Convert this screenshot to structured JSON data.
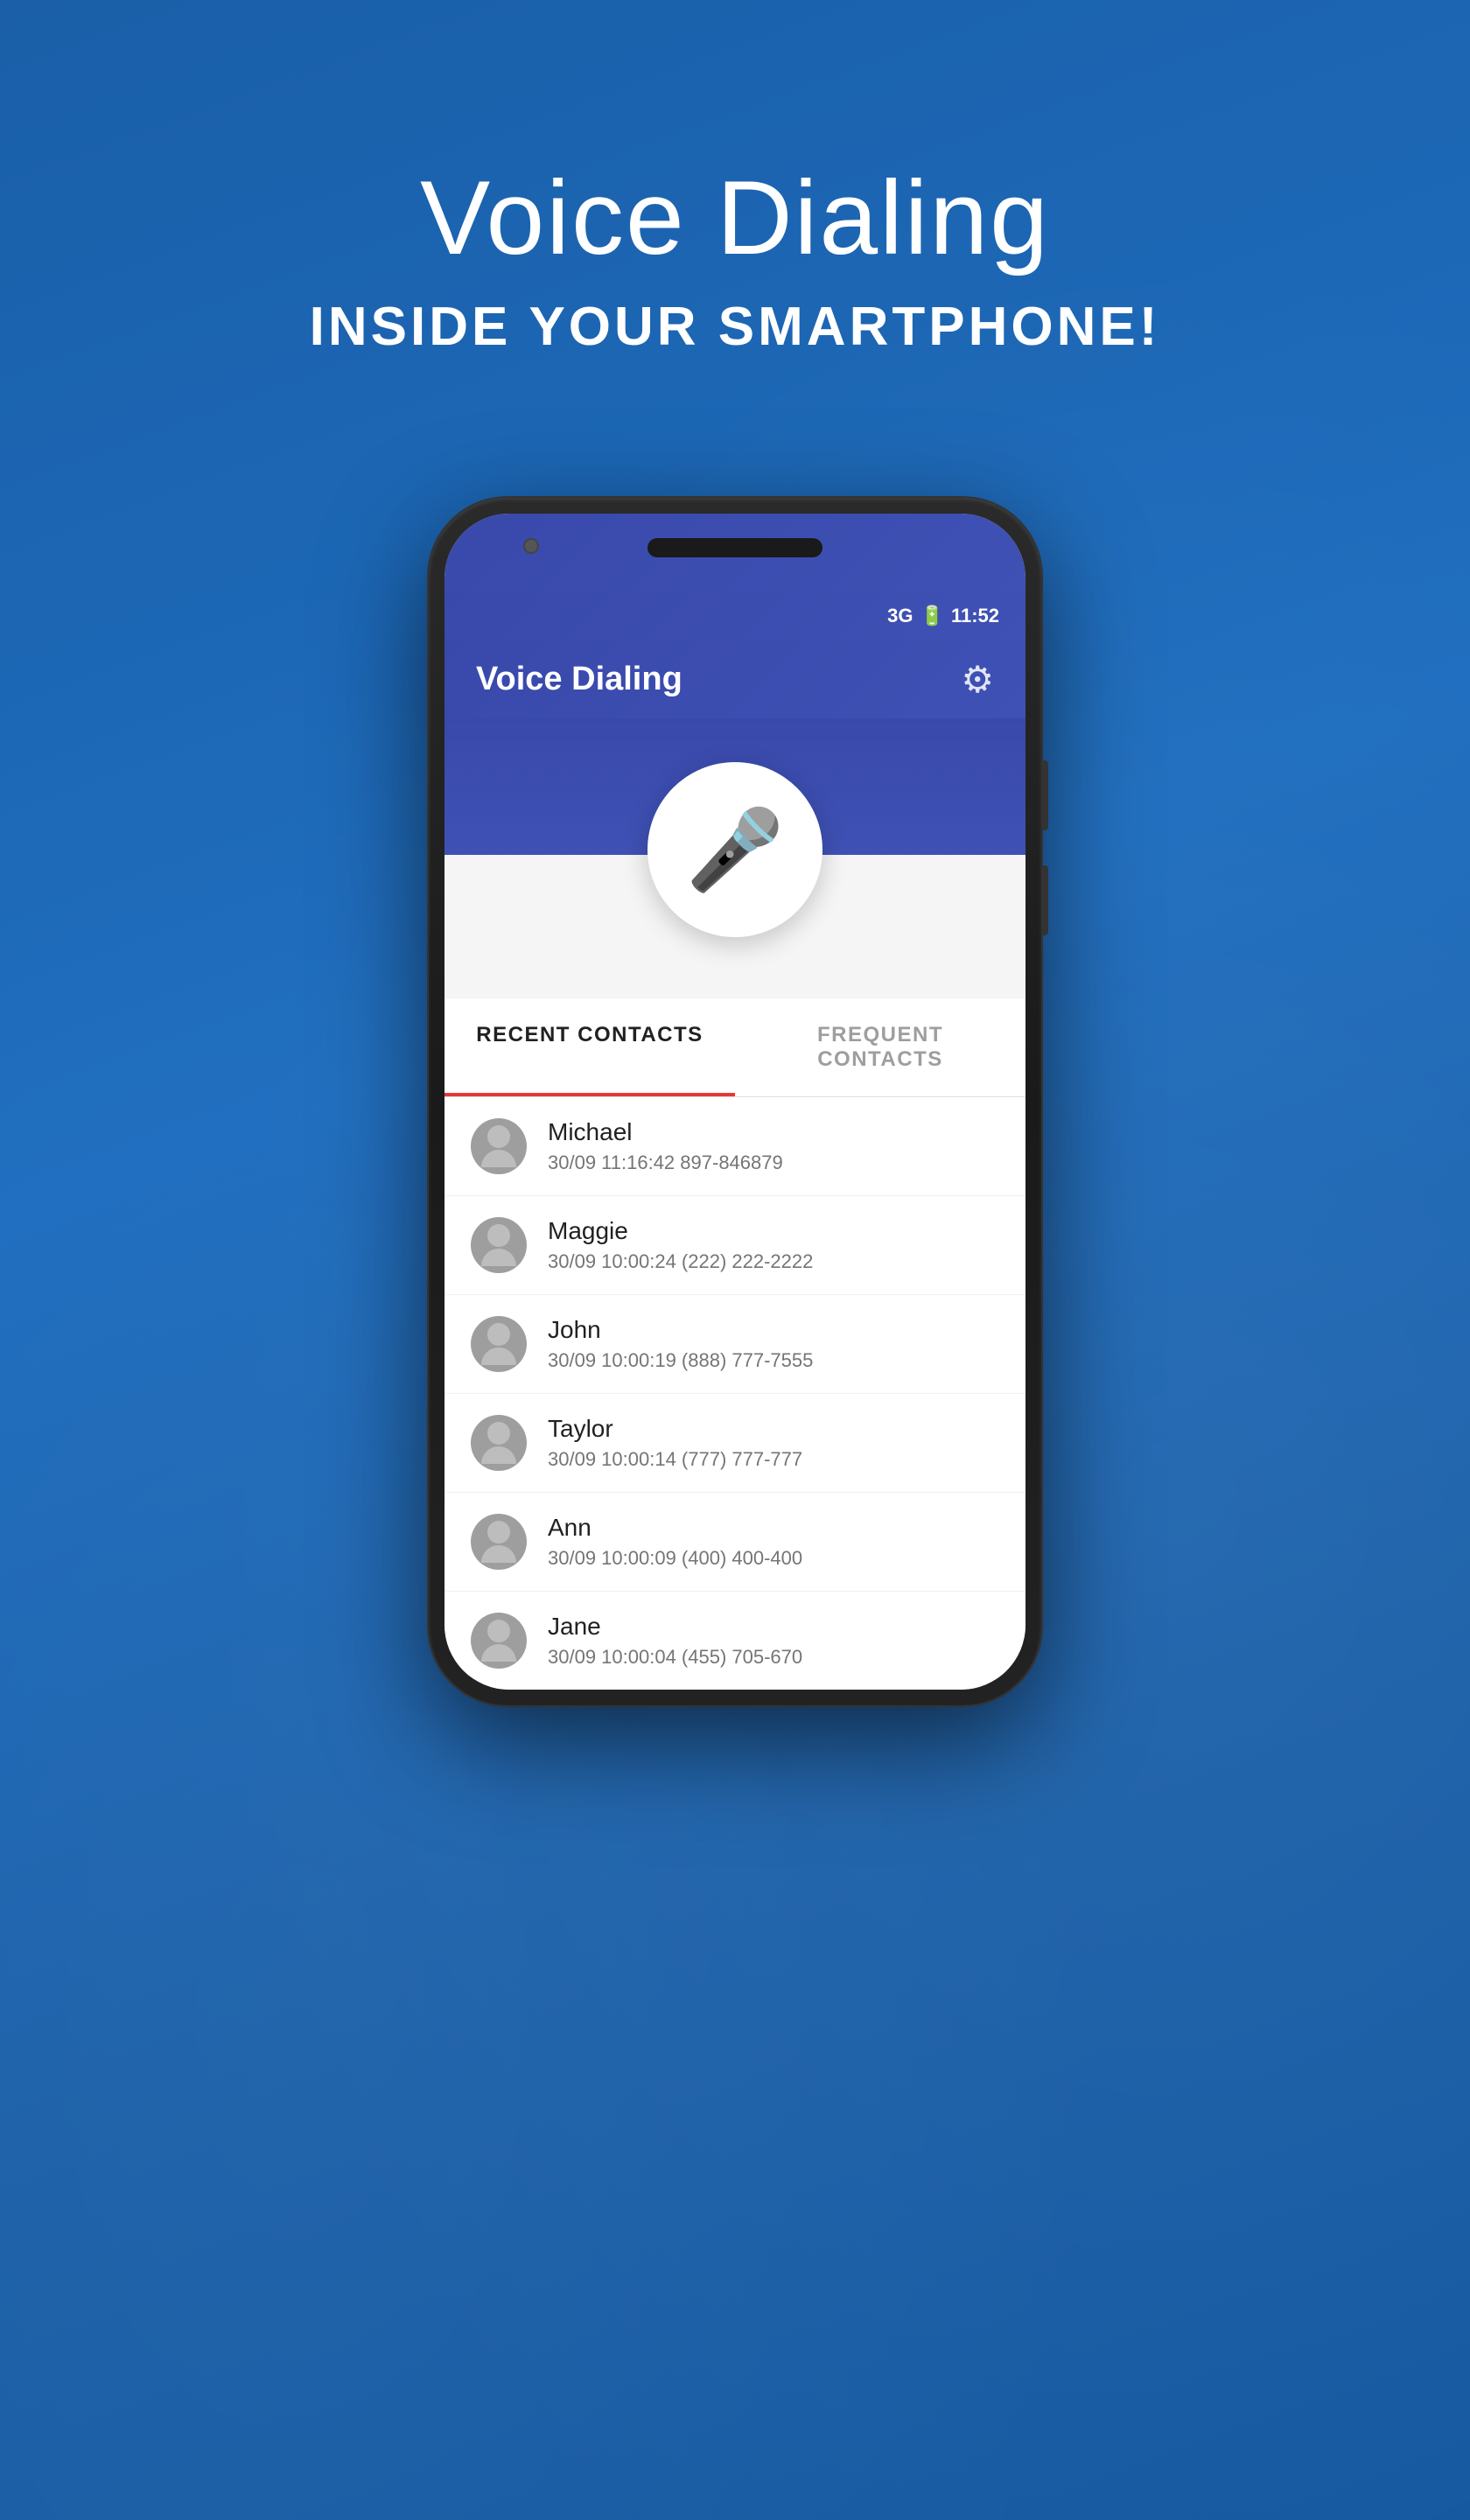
{
  "hero": {
    "title": "Voice Dialing",
    "subtitle": "INSIDE YOUR SMARTPHONE!"
  },
  "phone": {
    "status_bar": {
      "network": "3G",
      "time": "11:52"
    },
    "app_bar": {
      "title": "Voice Dialing",
      "settings_icon": "⚙"
    },
    "mic_label": "microphone",
    "tabs": [
      {
        "label": "RECENT CONTACTS",
        "active": true
      },
      {
        "label": "FREQUENT CONTACTS",
        "active": false
      }
    ],
    "contacts": [
      {
        "name": "Michael",
        "detail": "30/09 11:16:42  897-846879"
      },
      {
        "name": "Maggie",
        "detail": "30/09 10:00:24  (222) 222-2222"
      },
      {
        "name": "John",
        "detail": "30/09 10:00:19  (888) 777-7555"
      },
      {
        "name": "Taylor",
        "detail": "30/09 10:00:14  (777) 777-777"
      },
      {
        "name": "Ann",
        "detail": "30/09 10:00:09  (400) 400-400"
      },
      {
        "name": "Jane",
        "detail": "30/09 10:00:04  (455) 705-670"
      }
    ]
  }
}
